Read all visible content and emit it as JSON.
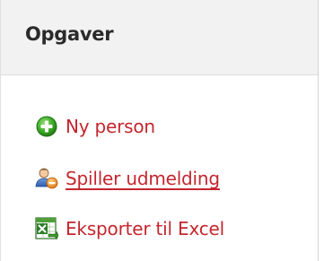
{
  "panel": {
    "title": "Opgaver"
  },
  "tasks": [
    {
      "label": "Ny person",
      "icon": "add-circle-icon"
    },
    {
      "label": "Spiller udmelding",
      "icon": "remove-user-icon"
    },
    {
      "label": "Eksporter til Excel",
      "icon": "excel-icon"
    }
  ],
  "colors": {
    "link": "#c4262e",
    "header_bg": "#f2f2f2",
    "title": "#2a2a2a"
  }
}
